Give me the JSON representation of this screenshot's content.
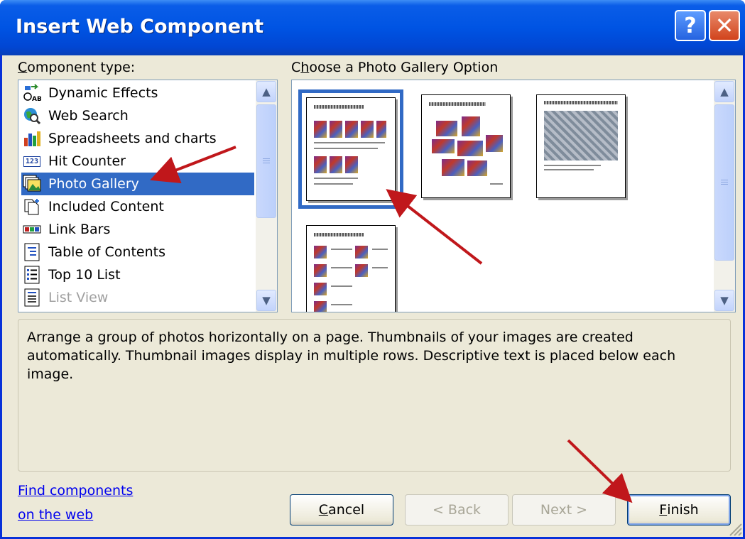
{
  "window": {
    "title": "Insert Web Component"
  },
  "titlebar_buttons": {
    "help": "?",
    "close": "✕"
  },
  "component_type": {
    "label_accel": "C",
    "label_rest": "omponent type:",
    "items": [
      {
        "label": "Dynamic Effects",
        "icon": "dynamic-effects-icon"
      },
      {
        "label": "Web Search",
        "icon": "web-search-icon"
      },
      {
        "label": "Spreadsheets and charts",
        "icon": "spreadsheets-icon"
      },
      {
        "label": "Hit Counter",
        "icon": "hit-counter-icon",
        "icon_text": "123"
      },
      {
        "label": "Photo Gallery",
        "icon": "photo-gallery-icon",
        "selected": true
      },
      {
        "label": "Included Content",
        "icon": "included-content-icon"
      },
      {
        "label": "Link Bars",
        "icon": "link-bars-icon"
      },
      {
        "label": "Table of Contents",
        "icon": "table-of-contents-icon"
      },
      {
        "label": "Top 10 List",
        "icon": "top-10-list-icon"
      },
      {
        "label": "List View",
        "icon": "list-view-icon",
        "disabled": true
      }
    ]
  },
  "gallery": {
    "label_pre": "C",
    "label_accel": "h",
    "label_rest": "oose a Photo Gallery Option",
    "selected_index": 0
  },
  "description": "Arrange a group of photos horizontally on a page. Thumbnails of your images are created automatically. Thumbnail images display in multiple rows. Descriptive text is placed below each image.",
  "links": {
    "line1": "Find components",
    "line2": "on the web"
  },
  "buttons": {
    "cancel_accel": "C",
    "cancel_rest": "ancel",
    "back": "< Back",
    "next": "Next >",
    "finish_accel": "F",
    "finish_rest": "inish"
  },
  "colors": {
    "selection": "#316ac5",
    "titlebar": "#0054e3",
    "annotation_arrow": "#c0171b"
  }
}
